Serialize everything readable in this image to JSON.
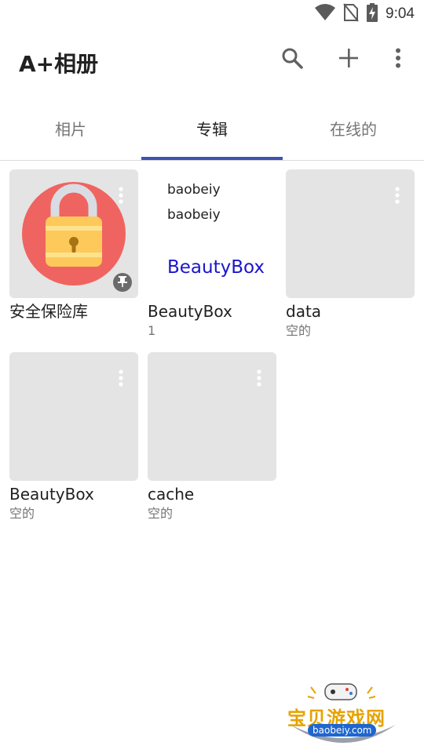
{
  "status_bar": {
    "time": "9:04"
  },
  "app_bar": {
    "title": "A+相册"
  },
  "tabs": [
    {
      "label": "相片"
    },
    {
      "label": "专辑"
    },
    {
      "label": "在线的"
    }
  ],
  "active_tab": "专辑",
  "albums": [
    {
      "name": "安全保险库",
      "count": ""
    },
    {
      "name": "BeautyBox",
      "count": "1",
      "preview": {
        "line1": "baobeiy",
        "line2": "baobeiy",
        "link": "BeautyBox"
      }
    },
    {
      "name": "data",
      "count": "空的"
    },
    {
      "name": "BeautyBox",
      "count": "空的"
    },
    {
      "name": "cache",
      "count": "空的"
    }
  ],
  "watermark": {
    "text": "宝贝游戏网",
    "url": "baobeiy.com"
  },
  "colors": {
    "accent": "#3f51b5",
    "vault_bg": "#ef6461",
    "lock_body": "#fdc95a",
    "link_blue": "#1a16c9"
  },
  "icons": [
    "wifi-icon",
    "no-sim-icon",
    "battery-charging-icon",
    "search-icon",
    "add-icon",
    "more-vert-icon",
    "lock-icon",
    "pin-icon"
  ]
}
